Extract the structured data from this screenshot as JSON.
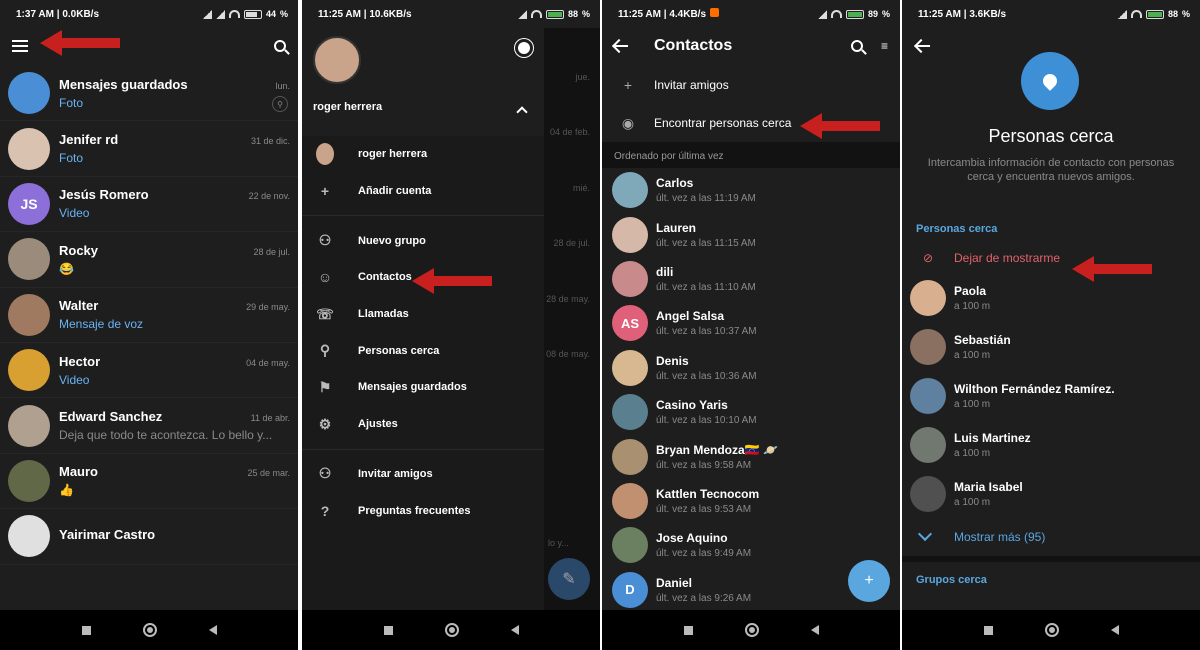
{
  "arrow_color": "#c8201e",
  "accent": "#5aa7e0",
  "panel1": {
    "status": {
      "left": "1:37 AM | 0.0KB/s",
      "battery": "44"
    },
    "chats": [
      {
        "name": "Mensajes guardados",
        "date": "lun.",
        "msg": "Foto",
        "color": "#4a8fd6",
        "initials": "",
        "msg_blue": true
      },
      {
        "name": "Jenifer rd",
        "date": "31 de dic.",
        "msg": "Foto",
        "color": "#d9c3b0",
        "initials": "",
        "msg_blue": true
      },
      {
        "name": "Jesús Romero",
        "date": "22 de nov.",
        "msg": "Video",
        "color": "#8c6fd8",
        "initials": "JS",
        "msg_blue": true
      },
      {
        "name": "Rocky",
        "date": "28 de jul.",
        "msg": "😂",
        "color": "#9b8b7a",
        "initials": "",
        "msg_blue": false
      },
      {
        "name": "Walter",
        "date": "29 de may.",
        "msg": "Mensaje de voz",
        "color": "#a07a60",
        "initials": "",
        "msg_blue": true
      },
      {
        "name": "Hector",
        "date": "04 de may.",
        "msg": "Video",
        "color": "#d8a030",
        "initials": "",
        "msg_blue": true
      },
      {
        "name": "Edward Sanchez",
        "date": "11 de abr.",
        "msg": "Deja que todo te acontezca. Lo bello y...",
        "color": "#b0a090",
        "initials": "",
        "msg_blue": false
      },
      {
        "name": "Mauro",
        "date": "25 de mar.",
        "msg": "👍",
        "color": "#606848",
        "initials": "",
        "msg_blue": false
      },
      {
        "name": "Yairimar Castro",
        "date": "",
        "msg": "",
        "color": "#e0e0e0",
        "initials": "",
        "msg_blue": false
      }
    ]
  },
  "panel2": {
    "status": {
      "left": "11:25 AM | 10.6KB/s",
      "battery": "88"
    },
    "user_name": "roger herrera",
    "account_name": "roger herrera",
    "add_account": "Añadir cuenta",
    "menu": [
      "Nuevo grupo",
      "Contactos",
      "Llamadas",
      "Personas cerca",
      "Mensajes guardados",
      "Ajustes"
    ],
    "menu2": [
      "Invitar amigos",
      "Preguntas frecuentes"
    ],
    "behind_dates": [
      "jue.",
      "04 de feb.",
      "mié.",
      "28 de jul.",
      "28 de may.",
      "08 de may.",
      "lo y..."
    ]
  },
  "panel3": {
    "status": {
      "left": "11:25 AM | 4.4KB/s",
      "battery": "89"
    },
    "title": "Contactos",
    "invite": "Invitar amigos",
    "find_nearby": "Encontrar personas cerca",
    "section": "Ordenado por última vez",
    "contacts": [
      {
        "name": "Carlos",
        "seen": "últ. vez a las 11:19 AM",
        "color": "#7fa8b8",
        "initials": ""
      },
      {
        "name": "Lauren",
        "seen": "últ. vez a las 11:15 AM",
        "color": "#d6b8a8",
        "initials": ""
      },
      {
        "name": "dili",
        "seen": "últ. vez a las 11:10 AM",
        "color": "#c88a8a",
        "initials": ""
      },
      {
        "name": "Angel Salsa",
        "seen": "últ. vez a las 10:37 AM",
        "color": "#e0607a",
        "initials": "AS"
      },
      {
        "name": "Denis",
        "seen": "últ. vez a las 10:36 AM",
        "color": "#d8b890",
        "initials": ""
      },
      {
        "name": "Casino Yaris",
        "seen": "últ. vez a las 10:10 AM",
        "color": "#5a8090",
        "initials": ""
      },
      {
        "name": "Bryan Mendoza🇻🇪 🪐",
        "seen": "últ. vez a las 9:58 AM",
        "color": "#a89070",
        "initials": ""
      },
      {
        "name": "Kattlen Tecnocom",
        "seen": "últ. vez a las 9:53 AM",
        "color": "#c09070",
        "initials": ""
      },
      {
        "name": "Jose Aquino",
        "seen": "últ. vez a las 9:49 AM",
        "color": "#6a8060",
        "initials": ""
      },
      {
        "name": "Daniel",
        "seen": "últ. vez a las 9:26 AM",
        "color": "#4a8fd6",
        "initials": "D"
      }
    ]
  },
  "panel4": {
    "status": {
      "left": "11:25 AM | 3.6KB/s",
      "battery": "88"
    },
    "title": "Personas cerca",
    "desc": "Intercambia información de contacto con personas cerca y encuentra nuevos amigos.",
    "section": "Personas cerca",
    "stop": "Dejar de mostrarme",
    "people": [
      {
        "name": "Paola",
        "dist": "a 100 m",
        "color": "#d8b090"
      },
      {
        "name": "Sebastián",
        "dist": "a 100 m",
        "color": "#8a7060"
      },
      {
        "name": "Wilthon Fernández Ramírez.",
        "dist": "a 100 m",
        "color": "#6080a0"
      },
      {
        "name": "Luis Martinez",
        "dist": "a 100 m",
        "color": "#707870"
      },
      {
        "name": "Maria Isabel",
        "dist": "a 100 m",
        "color": "#505050"
      }
    ],
    "more": "Mostrar más (95)",
    "groups": "Grupos cerca"
  }
}
